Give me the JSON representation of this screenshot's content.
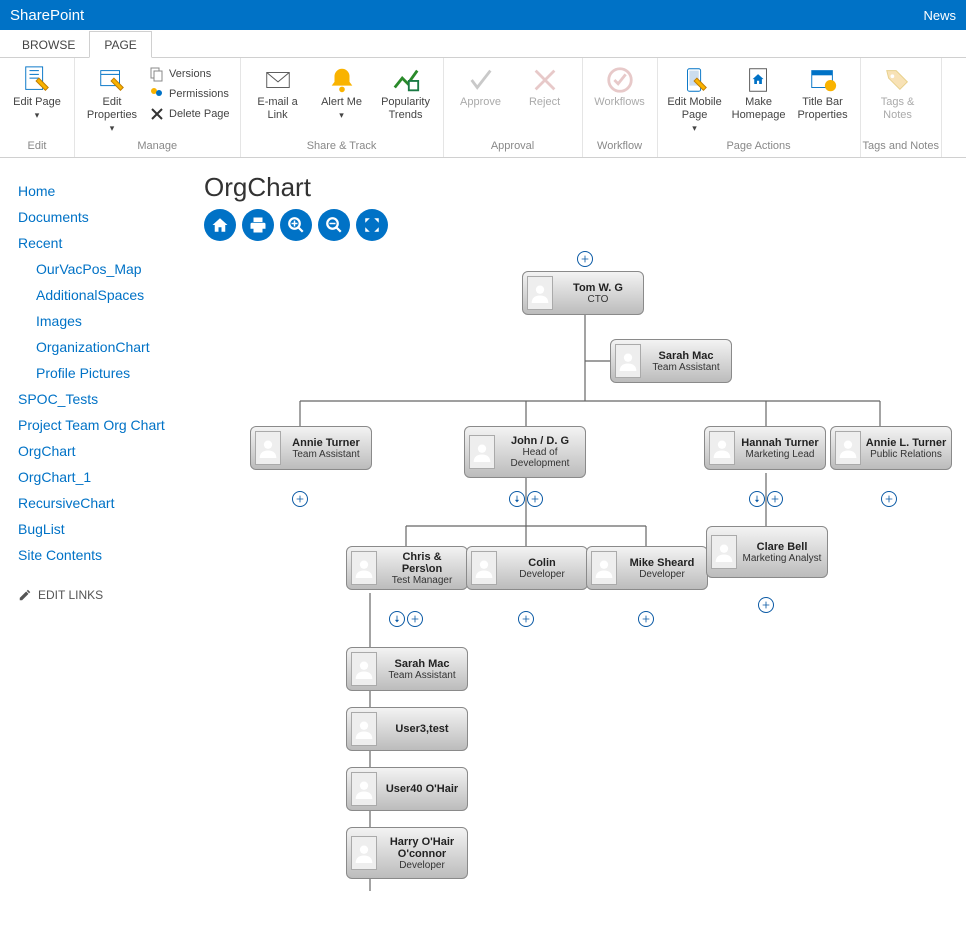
{
  "topbar": {
    "brand": "SharePoint",
    "right": "News"
  },
  "tabs": {
    "browse": "BROWSE",
    "page": "PAGE"
  },
  "ribbon": {
    "edit": {
      "label": "Edit",
      "edit_page": "Edit Page"
    },
    "manage": {
      "label": "Manage",
      "edit_properties": "Edit Properties",
      "versions": "Versions",
      "permissions": "Permissions",
      "delete_page": "Delete Page"
    },
    "share_track": {
      "label": "Share & Track",
      "email_link": "E-mail a Link",
      "alert_me": "Alert Me",
      "popularity": "Popularity Trends"
    },
    "approval": {
      "label": "Approval",
      "approve": "Approve",
      "reject": "Reject"
    },
    "workflow": {
      "label": "Workflow",
      "workflows": "Workflows"
    },
    "page_actions": {
      "label": "Page Actions",
      "edit_mobile": "Edit Mobile Page",
      "make_homepage": "Make Homepage",
      "titlebar_props": "Title Bar Properties"
    },
    "tags_notes": {
      "label": "Tags and Notes",
      "tags_notes": "Tags & Notes"
    }
  },
  "sidebar": {
    "home": "Home",
    "documents": "Documents",
    "recent": "Recent",
    "recent_items": {
      "ourvac": "OurVacPos_Map",
      "addspaces": "AdditionalSpaces",
      "images": "Images",
      "orgchart": "OrganizationChart",
      "profilepics": "Profile Pictures"
    },
    "spoc_tests": "SPOC_Tests",
    "project_team": "Project Team Org Chart",
    "orgchart": "OrgChart",
    "orgchart_1": "OrgChart_1",
    "recursive": "RecursiveChart",
    "buglist": "BugList",
    "site_contents": "Site Contents",
    "edit_links": "EDIT LINKS"
  },
  "page": {
    "title": "OrgChart"
  },
  "nodes": {
    "tom": {
      "name": "Tom W. G",
      "title": "CTO"
    },
    "sarah1": {
      "name": "Sarah Mac",
      "title": "Team Assistant"
    },
    "annie": {
      "name": "Annie Turner",
      "title": "Team Assistant"
    },
    "john": {
      "name": "John / D. G",
      "title": "Head of Development"
    },
    "hannah": {
      "name": "Hannah Turner",
      "title": "Marketing Lead"
    },
    "anniel": {
      "name": "Annie L. Turner",
      "title": "Public Relations"
    },
    "chris": {
      "name": "Chris & Pers\\on",
      "title": "Test Manager"
    },
    "colin": {
      "name": "Colin",
      "title": "Developer"
    },
    "mike": {
      "name": "Mike Sheard",
      "title": "Developer"
    },
    "clare": {
      "name": "Clare Bell",
      "title": "Marketing Analyst"
    },
    "sarah2": {
      "name": "Sarah Mac",
      "title": "Team Assistant"
    },
    "user3": {
      "name": "User3,test",
      "title": ""
    },
    "user40": {
      "name": "User40 O'Hair",
      "title": ""
    },
    "harry": {
      "name": "Harry O'Hair O'connor",
      "title": "Developer"
    }
  }
}
